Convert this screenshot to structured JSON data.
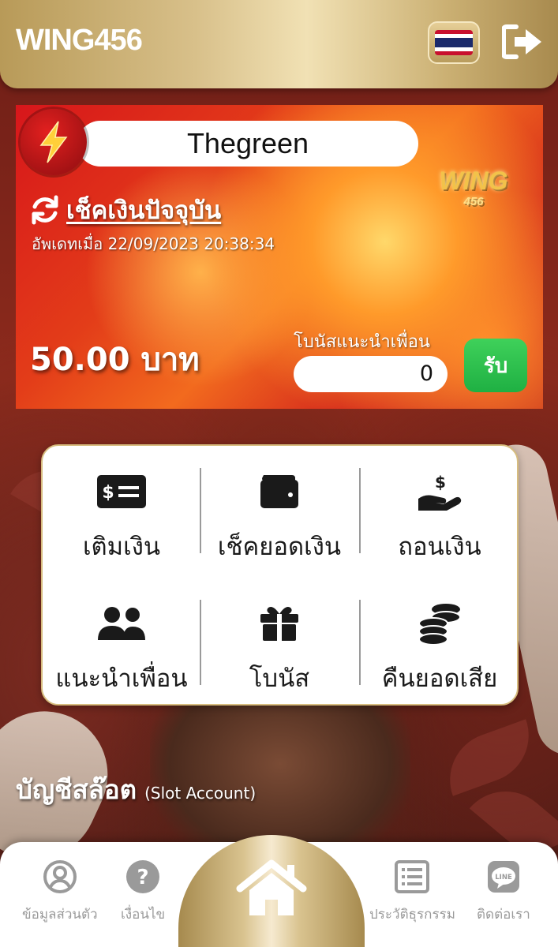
{
  "header": {
    "brand": "WING456",
    "language_flag": "thailand-flag-icon",
    "logout_icon": "sign-out-icon"
  },
  "card": {
    "username": "Thegreen",
    "logo_text": "WING",
    "logo_sub": "456",
    "check_balance_label": "เช็คเงินปัจจุบัน",
    "updated_text": "อัพเดทเมื่อ 22/09/2023 20:38:34",
    "balance_text": "50.00 บาท",
    "referral_bonus_label": "โบนัสแนะนำเพื่อน",
    "referral_bonus_value": "0",
    "claim_label": "รับ",
    "colors": {
      "claim": "#25b848",
      "card_red": "#d7161b"
    }
  },
  "menu": {
    "items": [
      {
        "label": "เติมเงิน",
        "icon": "money-bill-icon"
      },
      {
        "label": "เช็คยอดเงิน",
        "icon": "wallet-icon"
      },
      {
        "label": "ถอนเงิน",
        "icon": "hand-holding-dollar-icon"
      },
      {
        "label": "แนะนำเพื่อน",
        "icon": "users-icon"
      },
      {
        "label": "โบนัส",
        "icon": "gift-icon"
      },
      {
        "label": "คืนยอดเสีย",
        "icon": "coins-icon"
      }
    ]
  },
  "section": {
    "title": "บัญชีสล๊อต",
    "subtitle": "(Slot Account)"
  },
  "bottom_nav": {
    "items": [
      {
        "label": "ข้อมูลส่วนตัว",
        "icon": "user-circle-icon"
      },
      {
        "label": "เงื่อนไข",
        "icon": "question-circle-icon"
      },
      {
        "label": "",
        "icon": "home-icon"
      },
      {
        "label": "ประวัติธุรกรรม",
        "icon": "list-icon"
      },
      {
        "label": "ติดต่อเรา",
        "icon": "line-icon"
      }
    ]
  }
}
